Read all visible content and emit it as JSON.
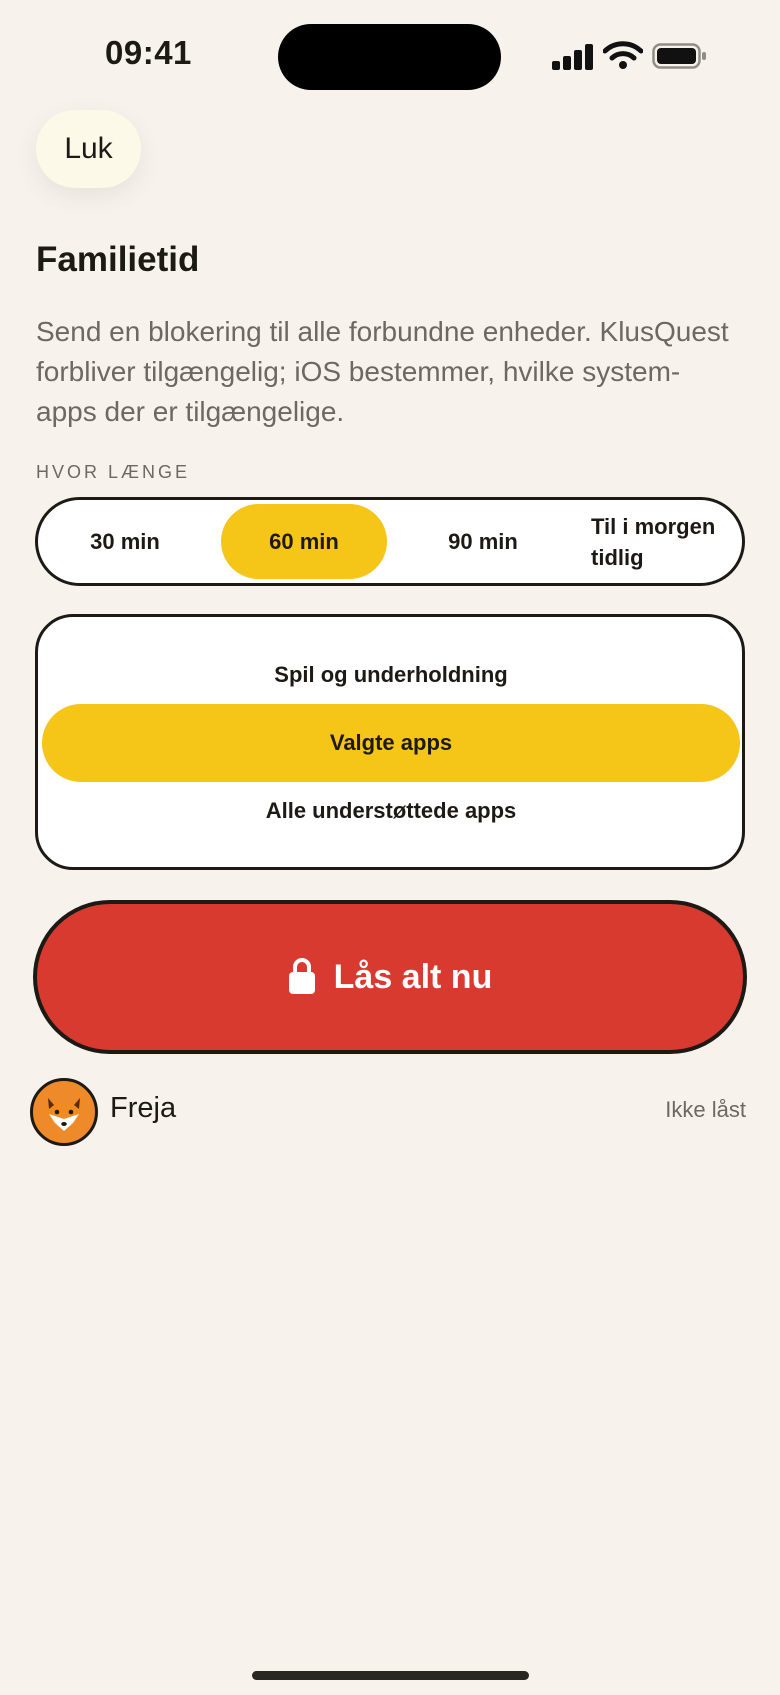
{
  "status_bar": {
    "time": "09:41"
  },
  "close_button": {
    "label": "Luk"
  },
  "title": "Familietid",
  "description": "Send en blokering til alle forbundne enheder. KlusQuest forbliver tilgængelig; iOS bestemmer, hvilke system-apps der er tilgængelige.",
  "duration": {
    "label": "HVOR LÆNGE",
    "options": [
      "30 min",
      "60 min",
      "90 min",
      "Til i morgen tidlig"
    ],
    "selected": "60 min"
  },
  "scope": {
    "options": [
      "Spil og underholdning",
      "Valgte apps",
      "Alle understøttede apps"
    ],
    "selected": "Valgte apps"
  },
  "lock_button": {
    "label": "Lås alt nu",
    "icon": "lock-icon"
  },
  "children": [
    {
      "name": "Freja",
      "status": "Ikke låst",
      "avatar_icon": "fox-icon"
    }
  ],
  "colors": {
    "background": "#f7f3ec",
    "accent_yellow": "#f5c518",
    "danger_red": "#d93a2f",
    "avatar_orange": "#ef8a2a"
  }
}
